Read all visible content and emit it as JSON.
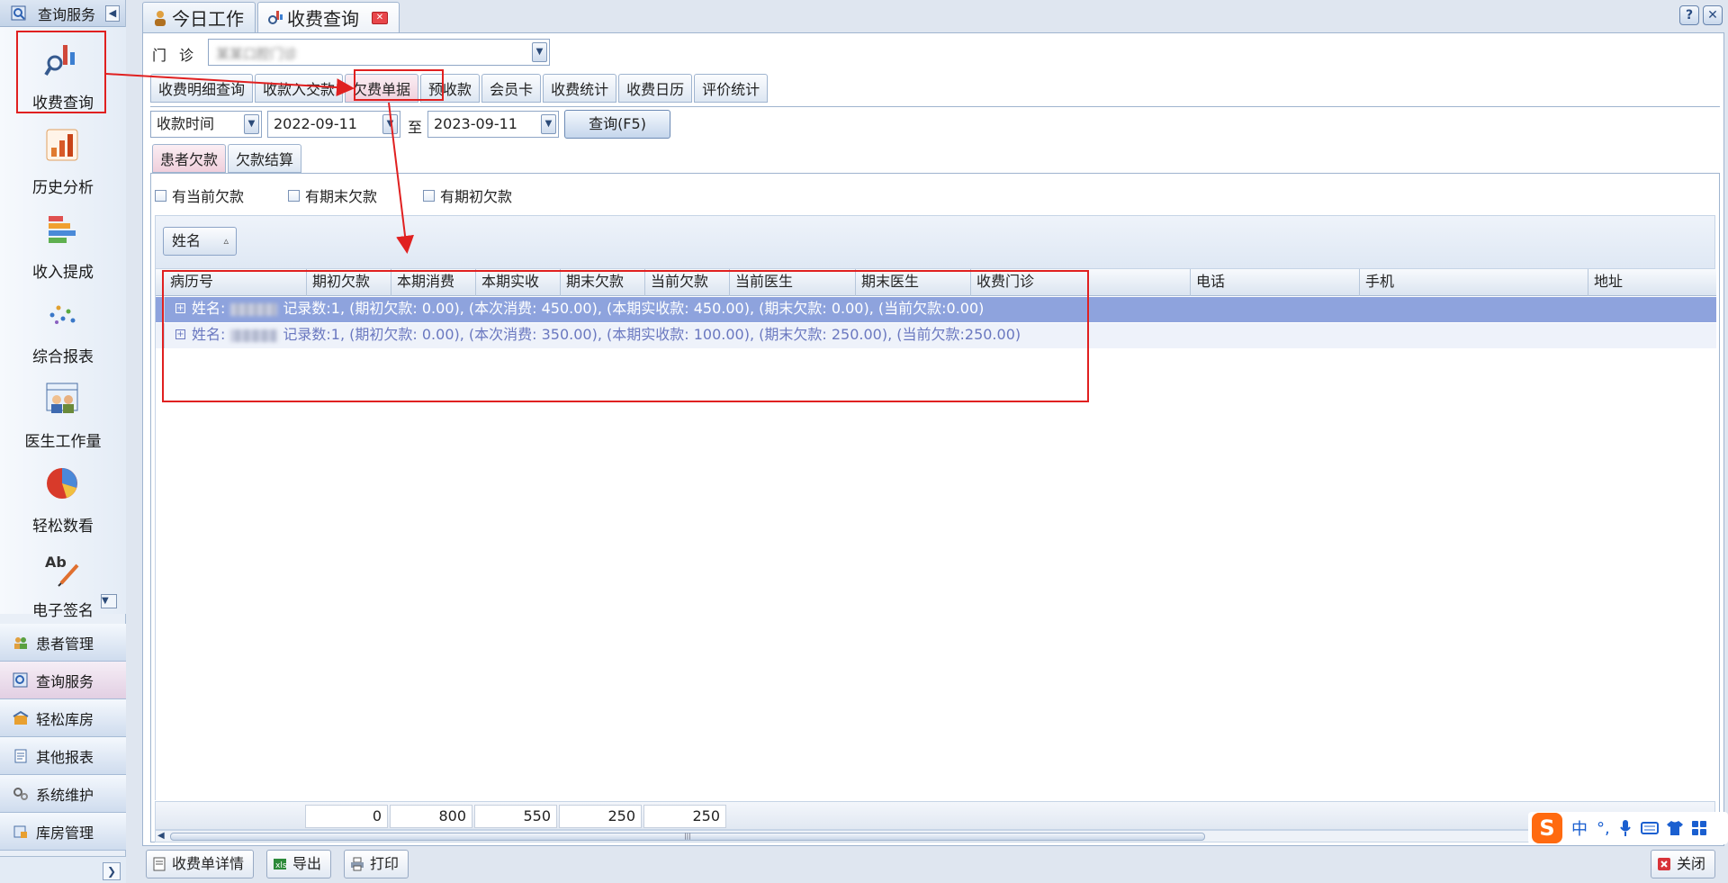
{
  "sidebar": {
    "header_title": "查询服务",
    "tiles": [
      {
        "label": "收费查询",
        "icon": "magnifier-chart-icon"
      },
      {
        "label": "历史分析",
        "icon": "bar-chart-icon"
      },
      {
        "label": "收入提成",
        "icon": "stacked-bars-icon"
      },
      {
        "label": "综合报表",
        "icon": "scatter-dots-icon"
      },
      {
        "label": "医生工作量",
        "icon": "doctor-calendar-icon"
      },
      {
        "label": "轻松数看",
        "icon": "pie-chart-icon"
      },
      {
        "label": "电子签名",
        "icon": "signature-pen-icon"
      }
    ],
    "groups": [
      {
        "label": "患者管理",
        "icon": "people-icon"
      },
      {
        "label": "查询服务",
        "icon": "search-doc-icon"
      },
      {
        "label": "轻松库房",
        "icon": "warehouse-icon"
      },
      {
        "label": "其他报表",
        "icon": "report-icon"
      },
      {
        "label": "系统维护",
        "icon": "gears-icon"
      },
      {
        "label": "库房管理",
        "icon": "inventory-icon"
      }
    ]
  },
  "top_tabs": [
    {
      "label": "今日工作",
      "icon": "person-icon"
    },
    {
      "label": "收费查询",
      "icon": "magnifier-chart-icon"
    }
  ],
  "clinic": {
    "label": "门诊",
    "value": "某某口腔门诊"
  },
  "sub_tabs": [
    "收费明细查询",
    "收款入交款",
    "欠费单据",
    "预收款",
    "会员卡",
    "收费统计",
    "收费日历",
    "评价统计"
  ],
  "query": {
    "time_type": "收款时间",
    "date_from": "2022-09-11",
    "to_label": "至",
    "date_to": "2023-09-11",
    "query_button": "查询(F5)"
  },
  "inner_tabs": [
    "患者欠款",
    "欠款结算"
  ],
  "filters": [
    "有当前欠款",
    "有期末欠款",
    "有期初欠款"
  ],
  "group_by": {
    "label": "姓名",
    "sort": "▵"
  },
  "columns": [
    "病历号",
    "期初欠款",
    "本期消费",
    "本期实收",
    "期末欠款",
    "当前欠款",
    "当前医生",
    "期末医生",
    "收费门诊",
    "电话",
    "手机",
    "地址"
  ],
  "rows": [
    {
      "prefix": "姓名:",
      "summary": "记录数:1, (期初欠款: 0.00), (本次消费: 450.00), (本期实收款: 450.00), (期末欠款: 0.00), (当前欠款:0.00)"
    },
    {
      "prefix": "姓名:",
      "summary": "记录数:1, (期初欠款: 0.00), (本次消费: 350.00), (本期实收款: 100.00), (期末欠款: 250.00), (当前欠款:250.00)"
    }
  ],
  "totals": [
    "0",
    "800",
    "550",
    "250",
    "250"
  ],
  "bottom_buttons": [
    {
      "label": "收费单详情",
      "icon": "receipt-icon"
    },
    {
      "label": "导出",
      "icon": "excel-export-icon"
    },
    {
      "label": "打印",
      "icon": "printer-icon"
    }
  ],
  "close_button": "关闭",
  "ime": {
    "logo": "S",
    "lang": "中"
  },
  "colors": {
    "highlight_red": "#e02020",
    "selected_row": "#8ea3dd"
  }
}
